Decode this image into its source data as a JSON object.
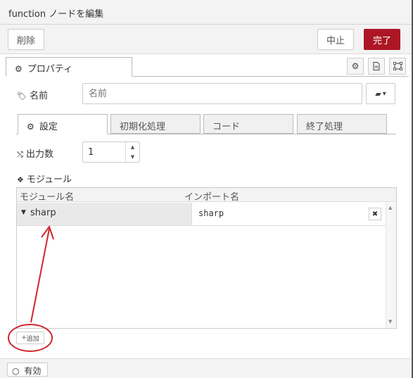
{
  "window": {
    "title": "function ノードを編集"
  },
  "toolbar": {
    "delete_label": "削除",
    "cancel_label": "中止",
    "done_label": "完了"
  },
  "tabs": {
    "properties_label": "プロパティ"
  },
  "name_field": {
    "label": "名前",
    "placeholder": "名前"
  },
  "subtabs": [
    "設定",
    "初期化処理",
    "コード",
    "終了処理"
  ],
  "outputs": {
    "label": "出力数",
    "value": "1"
  },
  "modules": {
    "label": "モジュール",
    "columns": [
      "モジュール名",
      "インポート名"
    ],
    "rows": [
      {
        "module": "sharp",
        "import": "sharp"
      }
    ],
    "add_label": "追加"
  },
  "footer": {
    "enabled_label": "有効"
  },
  "colors": {
    "primary": "#ad1625",
    "annotation": "#d0262d"
  },
  "icons": [
    "gear-icon",
    "description-icon",
    "appearance-icon",
    "tag-icon",
    "book-icon",
    "shuffle-icon",
    "cubes-icon",
    "caret-down-icon",
    "close-icon",
    "plus-icon",
    "circle-icon"
  ]
}
